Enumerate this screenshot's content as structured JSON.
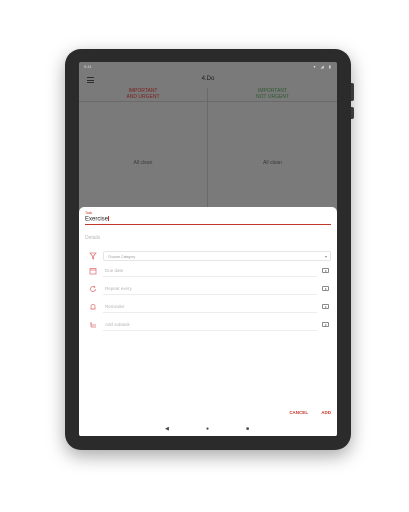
{
  "status_bar": {
    "time": "9:41",
    "icons": "▾ ◢ ▮"
  },
  "app": {
    "title": "4.Do"
  },
  "quadrants": [
    {
      "line1": "IMPORTANT",
      "line2": "AND URGENT",
      "empty": "All clean",
      "color": "#7a1e1e"
    },
    {
      "line1": "IMPORTANT",
      "line2": "NOT URGENT",
      "empty": "All clean",
      "color": "#2d5a2d"
    }
  ],
  "sheet": {
    "task_label": "Task",
    "task_value": "Exercise",
    "details_label": "Details",
    "category_placeholder": "Choose Category",
    "rows": [
      {
        "label": "Due date",
        "icon": "calendar-icon"
      },
      {
        "label": "Repeat every",
        "icon": "repeat-icon"
      },
      {
        "label": "Reminder",
        "icon": "bell-icon"
      },
      {
        "label": "Add subtask",
        "icon": "subtask-icon"
      }
    ],
    "cancel": "CANCEL",
    "add": "ADD"
  },
  "navbar": {
    "back": "◀",
    "home": "●",
    "recents": "■"
  },
  "colors": {
    "accent": "#c0392b",
    "sheet_bg": "#ffffff",
    "overlay": "#7a7a7a"
  }
}
